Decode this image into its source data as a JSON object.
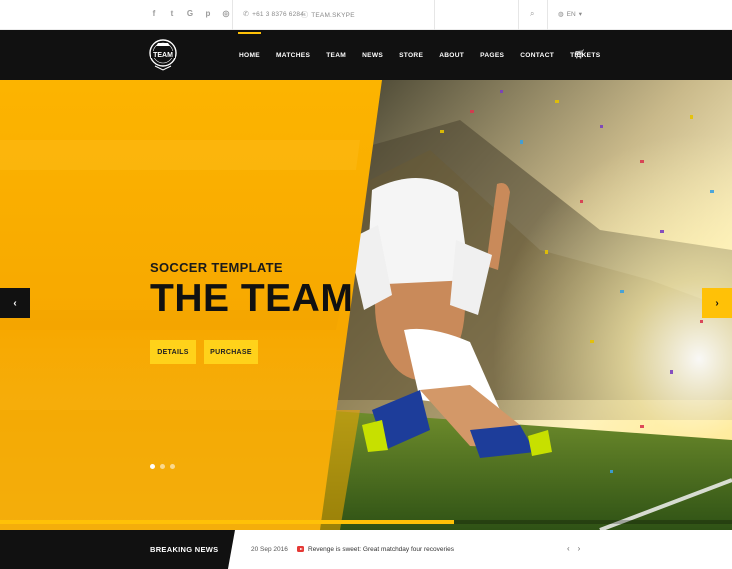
{
  "topbar": {
    "social_icons": [
      "facebook-icon",
      "twitter-icon",
      "google-icon",
      "pinterest-icon",
      "instagram-icon"
    ],
    "social_glyphs": [
      "f",
      "t",
      "G",
      "p",
      "◎"
    ],
    "phone_icon": "phone-icon",
    "phone": "+61 3 8376 6284",
    "skype_icon": "skype-icon",
    "skype": "TEAM.SKYPE",
    "search_icon": "search-icon",
    "language": "EN"
  },
  "logo": {
    "text": "TEAM"
  },
  "nav": {
    "items": [
      "HOME",
      "MATCHES",
      "TEAM",
      "NEWS",
      "STORE",
      "ABOUT",
      "PAGES",
      "CONTACT",
      "TICKETS"
    ],
    "active_index": 0,
    "cart_icon": "cart-icon"
  },
  "hero": {
    "kicker": "SOCCER TEMPLATE",
    "title": "THE TEAM",
    "details_label": "DETAILS",
    "purchase_label": "PURCHASE",
    "prev_arrow": "‹",
    "next_arrow": "›",
    "slide_count": 3,
    "active_slide": 0,
    "progress": 0.62
  },
  "news": {
    "label": "BREAKING NEWS",
    "date": "20 Sep 2016",
    "headline": "Revenge is sweet: Great matchday four recoveries",
    "prev": "‹",
    "next": "›"
  },
  "colors": {
    "accent": "#ffc107",
    "dark": "#111111",
    "hero_yellow": "#f9b000"
  }
}
